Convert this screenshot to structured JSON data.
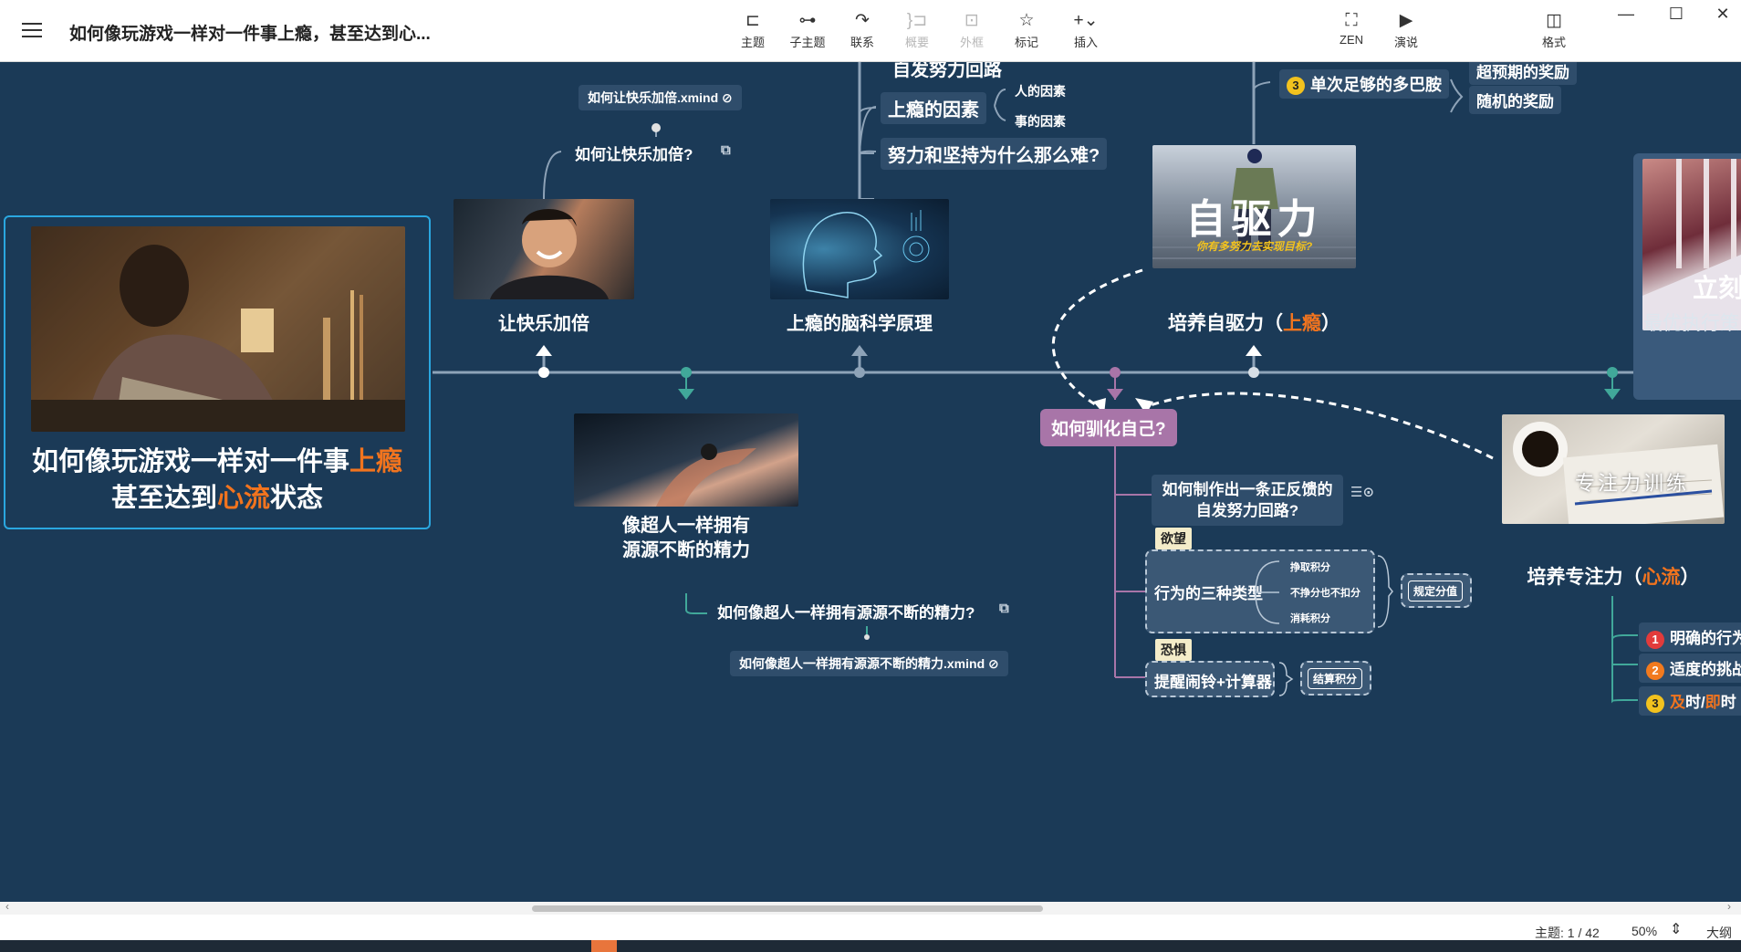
{
  "window": {
    "title": "如何像玩游戏一样对一件事上瘾，甚至达到心...",
    "minimize": "—",
    "maximize": "☐",
    "close": "✕"
  },
  "toolbar": {
    "left": [
      {
        "label": "主题",
        "icon": "topic-icon",
        "glyph": "⊏"
      },
      {
        "label": "子主题",
        "icon": "subtopic-icon",
        "glyph": "⊶"
      },
      {
        "label": "联系",
        "icon": "relationship-icon",
        "glyph": "↷"
      },
      {
        "label": "概要",
        "icon": "summary-icon",
        "glyph": "}⊐"
      },
      {
        "label": "外框",
        "icon": "boundary-icon",
        "glyph": "⊡"
      },
      {
        "label": "标记",
        "icon": "star-icon",
        "glyph": "☆"
      },
      {
        "label": "插入",
        "icon": "insert-icon",
        "glyph": "+⌄"
      }
    ],
    "right": [
      {
        "label": "ZEN",
        "icon": "zen-icon",
        "glyph": "⛶"
      },
      {
        "label": "演说",
        "icon": "present-icon",
        "glyph": "▶"
      },
      {
        "label": "格式",
        "icon": "format-icon",
        "glyph": "◫"
      }
    ]
  },
  "map": {
    "root": {
      "line1_a": "如何像玩游戏一样对一件事",
      "line1_b": "上瘾",
      "line2_a": "甚至达到",
      "line2_b": "心流",
      "line2_c": "状态"
    },
    "branch_happy": {
      "label": "让快乐加倍",
      "sub": "如何让快乐加倍?",
      "file": "如何让快乐加倍.xmind"
    },
    "branch_brain": {
      "label": "上瘾的脑科学原理",
      "top_partial": "自发努力回路",
      "factors": "上瘾的因素",
      "factor_people": "人的因素",
      "factor_things": "事的因素",
      "why_hard": "努力和坚持为什么那么难?"
    },
    "branch_energy": {
      "line1": "像超人一样拥有",
      "line2": "源源不断的精力",
      "sub": "如何像超人一样拥有源源不断的精力?",
      "file": "如何像超人一样拥有源源不断的精力.xmind"
    },
    "branch_drive": {
      "label_a": "培养自驱力（",
      "label_b": "上瘾",
      "label_c": "）",
      "img_title": "自驱力",
      "img_sub": "你有多努力去实现目标?",
      "dopamine": "单次足够的多巴胺",
      "dopamine_num": "3",
      "reward_partial": "超预期的奖励",
      "reward_random": "随机的奖励"
    },
    "branch_tame": {
      "label": "如何驯化自己?",
      "loop_line1": "如何制作出一条正反馈的",
      "loop_line2": "自发努力回路?",
      "tag_desire": "欲望",
      "types": "行为的三种类型",
      "type1": "挣取积分",
      "type2": "不挣分也不扣分",
      "type3": "消耗积分",
      "rule": "规定分值",
      "tag_fear": "恐惧",
      "alarm": "提醒闹铃+计算器",
      "settle": "结算积分"
    },
    "branch_focus": {
      "label_a": "培养专注力（",
      "label_b": "心流",
      "label_c": "）",
      "img_title": "专注力训练",
      "i1_num": "1",
      "i1": "明确的行为",
      "i2_num": "2",
      "i2": "适度的挑战",
      "i3_num": "3",
      "i3_a": "及",
      "i3_b": "时/",
      "i3_c": "即",
      "i3_d": "时"
    },
    "branch_exec": {
      "label": "最优执行策",
      "img_text": "立刻"
    }
  },
  "status": {
    "topics": "主题: 1 / 42",
    "zoom": "50%",
    "outline": "大纲"
  },
  "colors": {
    "canvas": "#1b3a57",
    "accent": "#f2741e",
    "purple": "#a875a8",
    "teal": "#41a89a"
  }
}
